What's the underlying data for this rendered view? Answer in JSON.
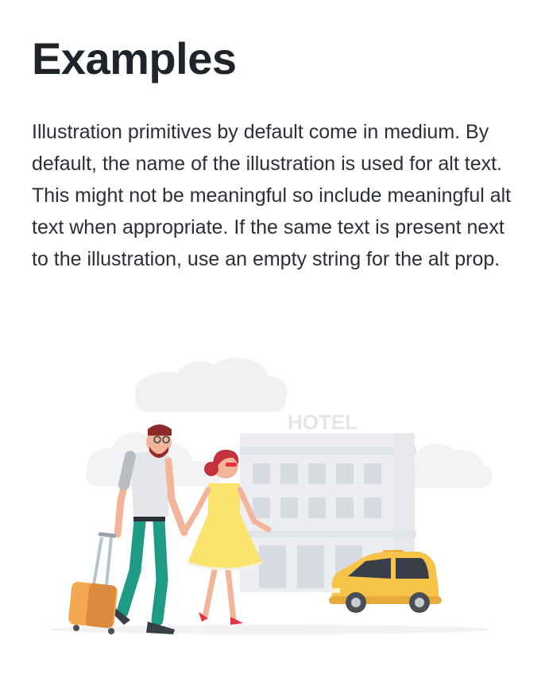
{
  "heading": "Examples",
  "description": "Illustration primitives by default come in medium. By default, the name of the illustration is used for alt text. This might not be meaningful so include meaningful alt text when appropriate. If the same text is present next to the illustration, use an empty string for the alt prop.",
  "illustration": {
    "sign_text": "HOTEL"
  }
}
